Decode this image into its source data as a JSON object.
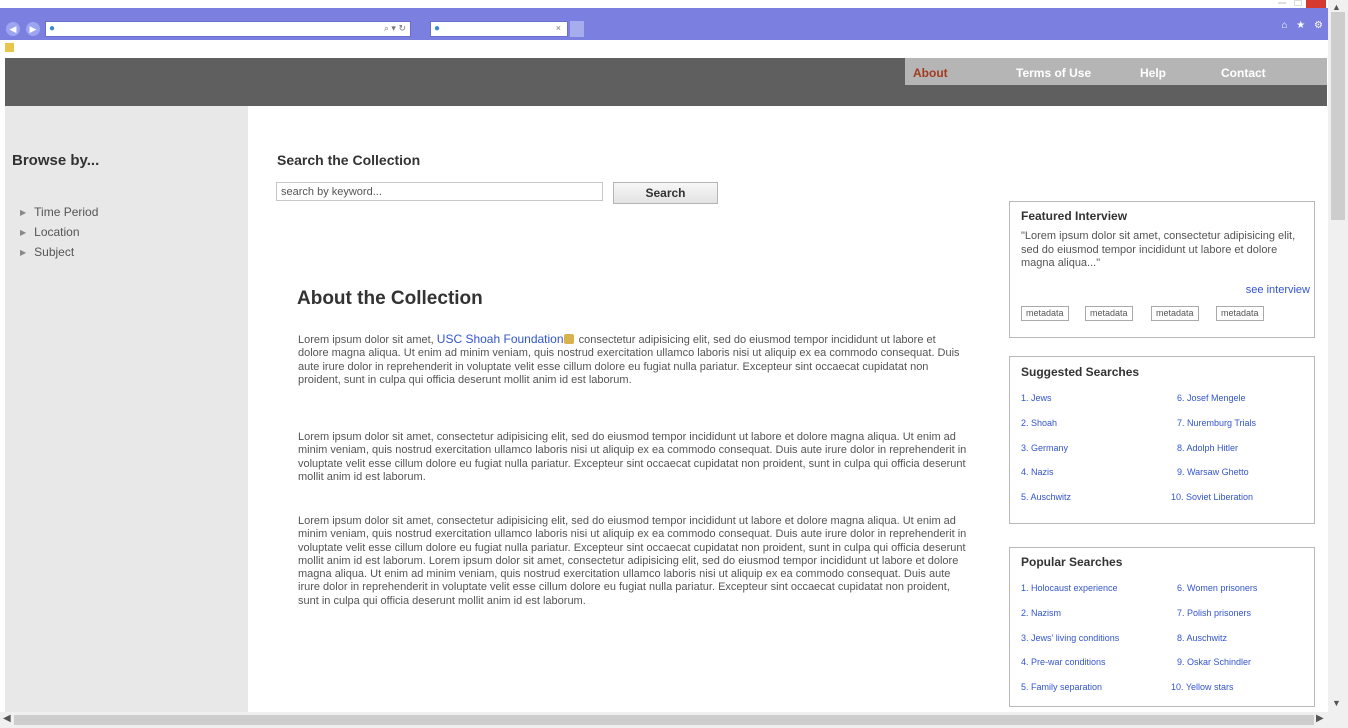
{
  "browser": {
    "address_controls": "⌕ ▾ ↻",
    "tab_close": "×",
    "right_icons": "⌂ ★ ⚙"
  },
  "nav": {
    "items": [
      "About",
      "Terms of Use",
      "Help",
      "Contact"
    ],
    "active_color": "#a33a22"
  },
  "sidebar": {
    "title": "Browse by...",
    "items": [
      "Time Period",
      "Location",
      "Subject"
    ]
  },
  "search": {
    "title": "Search the Collection",
    "value": "search by keyword...",
    "button_label": "Search"
  },
  "about": {
    "title": "About the Collection",
    "para1_before_link": "Lorem ipsum dolor sit amet, ",
    "para1_link": "USC Shoah Foundation",
    "para1_after_link": " consectetur adipisicing elit, sed do eiusmod tempor incididunt ut labore et dolore magna aliqua. Ut enim ad minim veniam, quis nostrud exercitation ullamco laboris nisi ut aliquip ex ea commodo consequat. Duis aute irure dolor in reprehenderit in voluptate velit esse cillum dolore eu fugiat nulla pariatur. Excepteur sint occaecat cupidatat non proident, sunt in culpa qui officia deserunt mollit anim id est laborum.",
    "para2": "Lorem ipsum dolor sit amet, consectetur adipisicing elit, sed do eiusmod tempor incididunt ut labore et dolore magna aliqua. Ut enim ad minim veniam, quis nostrud exercitation ullamco laboris nisi ut aliquip ex ea commodo consequat. Duis aute irure dolor in reprehenderit in voluptate velit esse cillum dolore eu fugiat nulla pariatur. Excepteur sint occaecat cupidatat non proident, sunt in culpa qui officia deserunt mollit anim id est laborum.",
    "para3": "Lorem ipsum dolor sit amet, consectetur adipisicing elit, sed do eiusmod tempor incididunt ut labore et dolore magna aliqua. Ut enim ad minim veniam, quis nostrud exercitation ullamco laboris nisi ut aliquip ex ea commodo consequat. Duis aute irure dolor in reprehenderit in voluptate velit esse cillum dolore eu fugiat nulla pariatur. Excepteur sint occaecat cupidatat non proident, sunt in culpa qui officia deserunt mollit anim id est laborum. Lorem ipsum dolor sit amet, consectetur adipisicing elit, sed do eiusmod tempor incididunt ut labore et dolore magna aliqua. Ut enim ad minim veniam, quis nostrud exercitation ullamco laboris nisi ut aliquip ex ea commodo consequat. Duis aute irure dolor in reprehenderit in voluptate velit esse cillum dolore eu fugiat nulla pariatur. Excepteur sint occaecat cupidatat non proident, sunt in culpa qui officia deserunt mollit anim id est laborum."
  },
  "featured": {
    "title": "Featured Interview",
    "quote": "\"Lorem ipsum dolor sit amet, consectetur adipisicing elit, sed do eiusmod tempor incididunt ut labore et dolore magna aliqua...\"",
    "link": "see interview",
    "tags": [
      "metadata",
      "metadata",
      "metadata",
      "metadata"
    ]
  },
  "suggested": {
    "title": "Suggested Searches",
    "col1": [
      "1. Jews",
      "2. Shoah",
      "3. Germany",
      "4. Nazis",
      "5. Auschwitz"
    ],
    "col2": [
      "6. Josef Mengele",
      "7. Nuremburg Trials",
      "8. Adolph Hitler",
      "9. Warsaw Ghetto",
      "10. Soviet Liberation"
    ]
  },
  "popular": {
    "title": "Popular Searches",
    "col1": [
      "1. Holocaust experience",
      "2. Nazism",
      "3. Jews' living conditions",
      "4. Pre-war conditions",
      "5. Family separation"
    ],
    "col2": [
      "6. Women prisoners",
      "7. Polish prisoners",
      "8. Auschwitz",
      "9. Oskar Schindler",
      "10. Yellow stars"
    ]
  }
}
